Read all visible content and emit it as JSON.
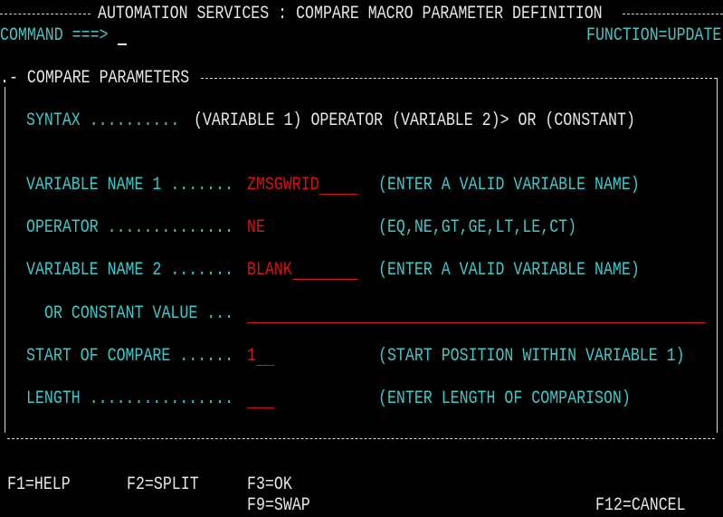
{
  "header": {
    "title": "AUTOMATION SERVICES : COMPARE MACRO PARAMETER DEFINITION",
    "command_label": "COMMAND ===>",
    "command_value": "",
    "function": "FUNCTION=UPDATE"
  },
  "panel": {
    "title": "- COMPARE PARAMETERS",
    "syntax_label": "SYNTAX ..........",
    "syntax_value": "(VARIABLE 1) OPERATOR (VARIABLE 2)> OR (CONSTANT)",
    "fields": [
      {
        "label": "VARIABLE NAME 1 .......",
        "value": "ZMSGWRID",
        "hint": "(ENTER A VALID VARIABLE NAME)"
      },
      {
        "label": "OPERATOR ..............",
        "value": "NE",
        "hint": "(EQ,NE,GT,GE,LT,LE,CT)"
      },
      {
        "label": "VARIABLE NAME 2 .......",
        "value": "BLANK",
        "hint": "(ENTER A VALID VARIABLE NAME)"
      },
      {
        "label": "OR CONSTANT VALUE ...",
        "value": "",
        "hint": ""
      },
      {
        "label": "START OF COMPARE ......",
        "value": "1",
        "hint": "(START POSITION WITHIN VARIABLE 1)"
      },
      {
        "label": "LENGTH ................",
        "value": "",
        "hint": "(ENTER LENGTH OF COMPARISON)"
      }
    ]
  },
  "function_keys": {
    "f1": "F1=HELP",
    "f2": "F2=SPLIT",
    "f3": "F3=OK",
    "f9": "F9=SWAP",
    "f12": "F12=CANCEL"
  },
  "colors": {
    "background": "#000000",
    "label": "#3ec8c8",
    "value": "#d41414",
    "text": "#e6e6e6"
  }
}
